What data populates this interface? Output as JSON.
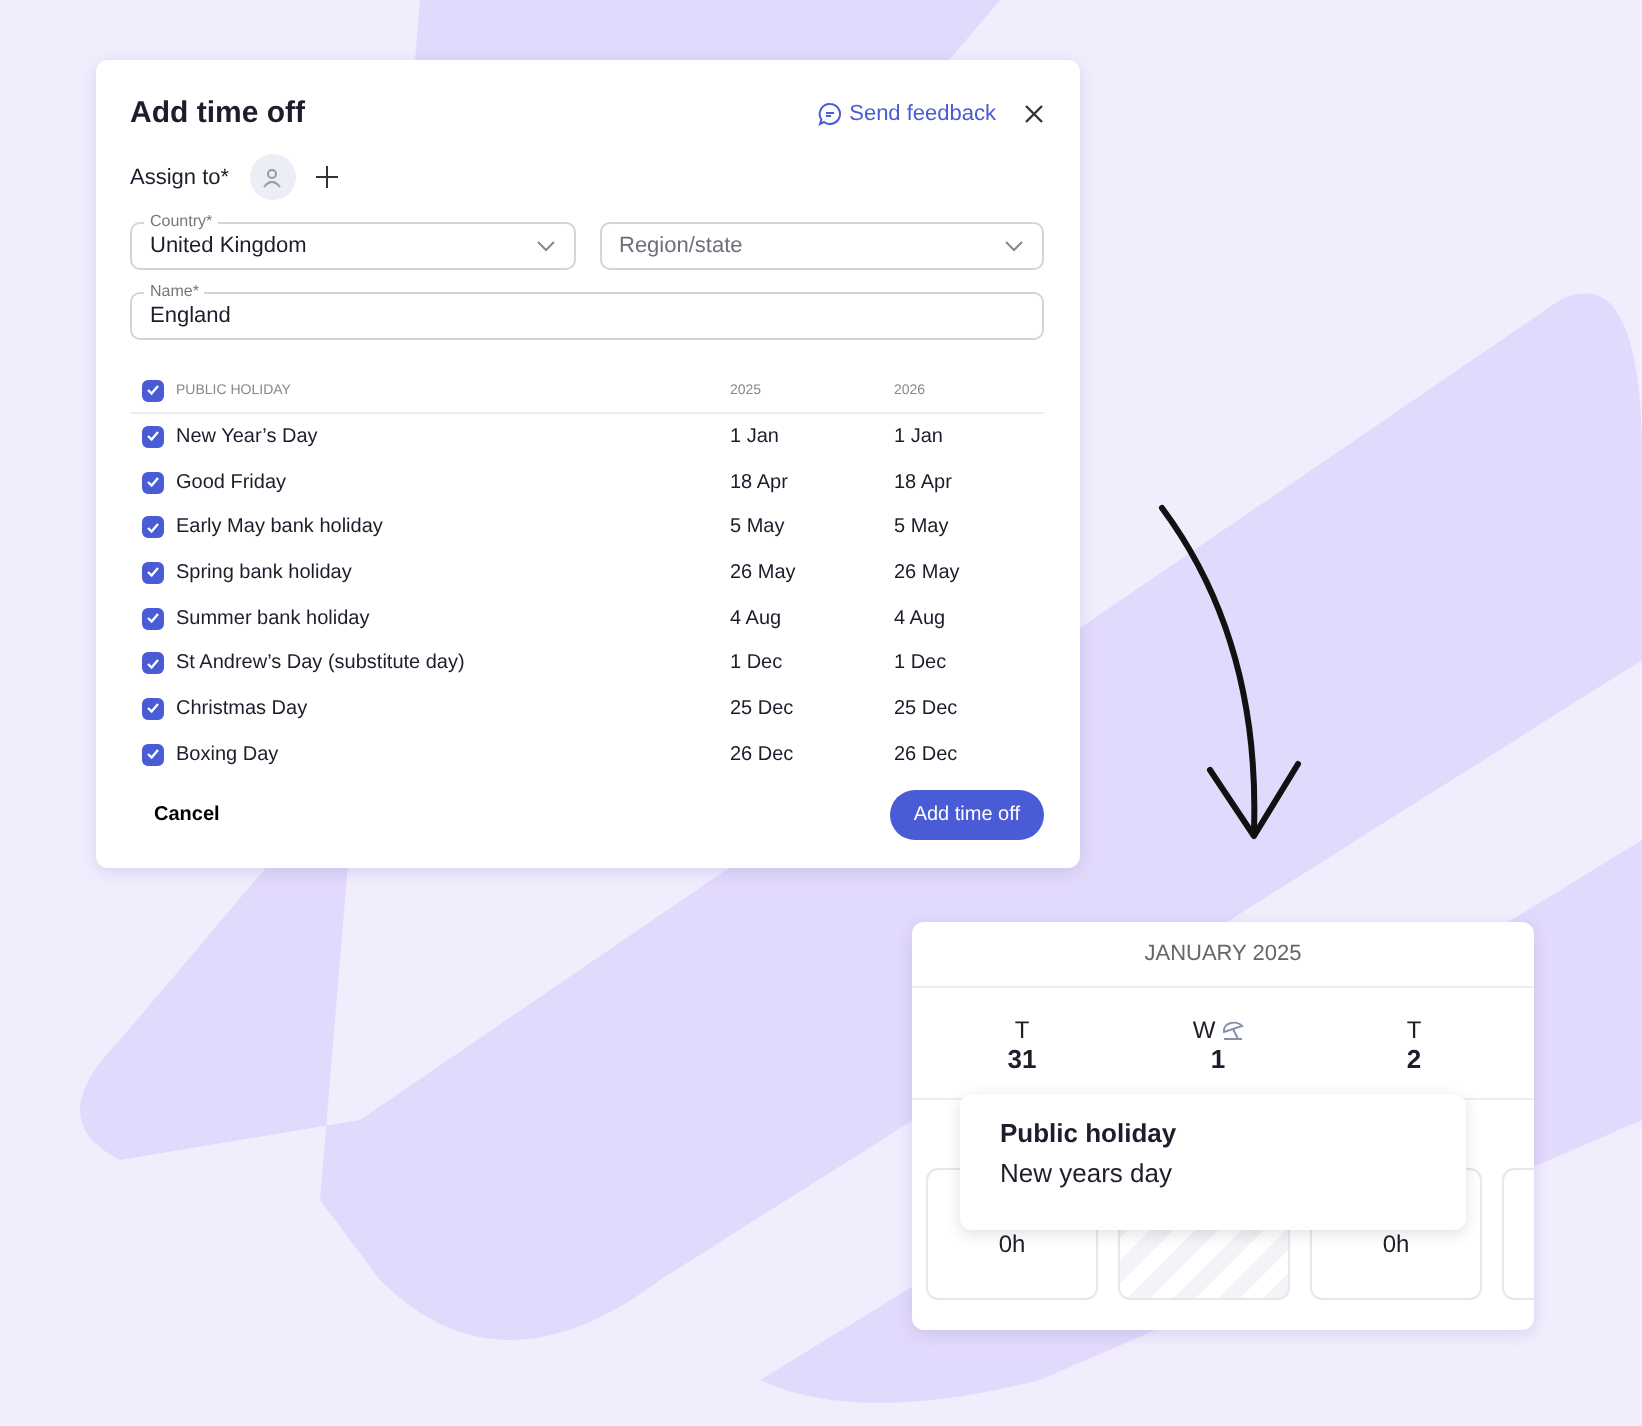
{
  "dialog": {
    "title": "Add time off",
    "feedback_link": "Send feedback",
    "assign_label": "Assign to*",
    "country": {
      "label": "Country*",
      "value": "United Kingdom"
    },
    "region": {
      "placeholder": "Region/state"
    },
    "name": {
      "label": "Name*",
      "value": "England"
    },
    "header": {
      "checked": true,
      "columns": [
        "PUBLIC HOLIDAY",
        "2025",
        "2026"
      ]
    },
    "rows": [
      {
        "name": "New Year’s Day",
        "date_2025": "1 Jan",
        "date_2026": "1 Jan",
        "checked": true
      },
      {
        "name": "Good Friday",
        "date_2025": "18 Apr",
        "date_2026": "18 Apr",
        "checked": true
      },
      {
        "name": "Early May bank holiday",
        "date_2025": "5 May",
        "date_2026": "5 May",
        "checked": true
      },
      {
        "name": "Spring bank holiday",
        "date_2025": "26 May",
        "date_2026": "26 May",
        "checked": true
      },
      {
        "name": "Summer bank holiday",
        "date_2025": "4 Aug",
        "date_2026": "4 Aug",
        "checked": true
      },
      {
        "name": "St Andrew’s Day (substitute day)",
        "date_2025": "1 Dec",
        "date_2026": "1 Dec",
        "checked": true
      },
      {
        "name": "Christmas Day",
        "date_2025": "25 Dec",
        "date_2026": "25 Dec",
        "checked": true
      },
      {
        "name": "Boxing Day",
        "date_2025": "26 Dec",
        "date_2026": "26 Dec",
        "checked": true
      }
    ],
    "cancel": "Cancel",
    "submit": "Add time off"
  },
  "calendar": {
    "month": "JANUARY 2025",
    "days": [
      {
        "weekday": "T",
        "date": "31",
        "holiday": false
      },
      {
        "weekday": "W",
        "date": "1",
        "holiday": true
      },
      {
        "weekday": "T",
        "date": "2",
        "holiday": false
      }
    ],
    "tooltip": {
      "title": "Public holiday",
      "text": "New years day"
    },
    "slots": [
      {
        "kind": "hours",
        "text": "0h"
      },
      {
        "kind": "holiday"
      },
      {
        "kind": "hours",
        "text": "0h"
      },
      {
        "kind": "partial"
      }
    ]
  }
}
